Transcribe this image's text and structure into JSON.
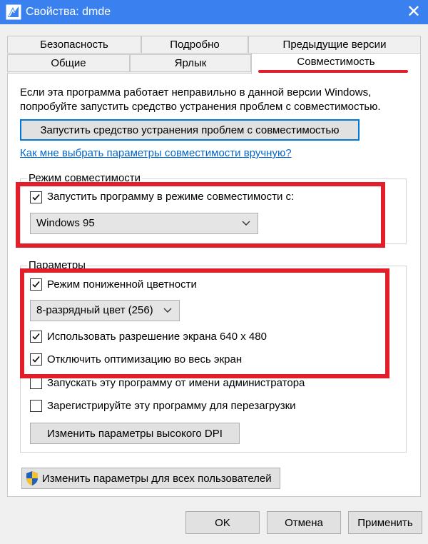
{
  "window": {
    "title": "Свойства: dmde",
    "close": "✕"
  },
  "tabs": {
    "row1": [
      "Безопасность",
      "Подробно",
      "Предыдущие версии"
    ],
    "row2": [
      "Общие",
      "Ярлык",
      "Совместимость"
    ],
    "active": "Совместимость"
  },
  "compat": {
    "intro_line1": "Если эта программа работает неправильно в данной версии Windows,",
    "intro_line2": "попробуйте запустить средство устранения проблем с совместимостью.",
    "troubleshoot_button": "Запустить средство устранения проблем с совместимостью",
    "manual_link": "Как мне выбрать параметры совместимости вручную?",
    "mode_group": {
      "legend": "Режим совместимости",
      "checkbox_label": "Запустить программу в режиме совместимости с:",
      "checked": true,
      "selected_os": "Windows 95"
    },
    "params_group": {
      "legend": "Параметры",
      "reduced_color": {
        "label": "Режим пониженной цветности",
        "checked": true
      },
      "color_depth": "8-разрядный цвет (256)",
      "res640": {
        "label": "Использовать разрешение экрана 640 х 480",
        "checked": true
      },
      "disable_fullscreen_opt": {
        "label": "Отключить оптимизацию во весь экран",
        "checked": true
      },
      "run_as_admin": {
        "label": "Запускать эту программу от имени администратора",
        "checked": false
      },
      "register_restart": {
        "label": "Зарегистрируйте эту программу для перезагрузки",
        "checked": false
      },
      "high_dpi_button": "Изменить параметры высокого DPI"
    },
    "all_users_button": "Изменить параметры для всех пользователей"
  },
  "footer": {
    "ok": "OK",
    "cancel": "Отмена",
    "apply": "Применить"
  },
  "colors": {
    "titlebar": "#3b80ef",
    "highlight": "#e21e2b",
    "link": "#0066cc"
  }
}
